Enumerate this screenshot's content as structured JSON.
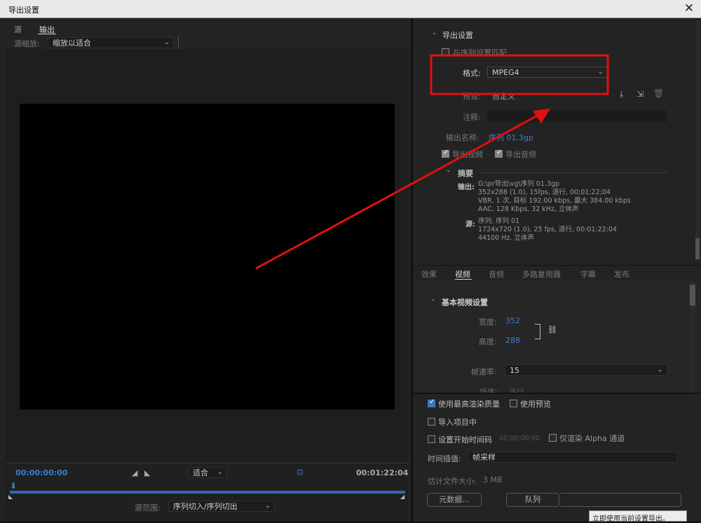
{
  "window": {
    "title": "导出设置",
    "close": "✕"
  },
  "left": {
    "tabs": [
      "源",
      "输出"
    ],
    "scale_label": "源缩放:",
    "scale_value": "缩放以适合",
    "tc_start": "00:00:00:00",
    "tc_end": "00:01:22:04",
    "fit_value": "适合",
    "range_label": "源范围:",
    "range_value": "序列切入/序列切出"
  },
  "export": {
    "section": "导出设置",
    "match_seq": "与序列设置匹配",
    "format_label": "格式:",
    "format_value": "MPEG4",
    "preset_label": "预设:",
    "preset_value": "自定义",
    "comment_label": "注释:",
    "output_name_label": "输出名称:",
    "output_name_value": "序列 01.3gp",
    "export_video": "导出视频",
    "export_audio": "导出音频",
    "summary_title": "摘要",
    "out_key": "输出:",
    "out_lines": [
      "G:\\pr导出\\vg\\序列 01.3gp",
      "352x288 (1.0), 15fps, 逐行, 00;01;22;04",
      "VBR, 1 次, 目标 192.00 kbps, 最大 384.00 kbps",
      "AAC, 128 Kbps, 32  kHz, 立体声"
    ],
    "src_key": "源:",
    "src_lines": [
      "序列, 序列 01",
      "1724x720 (1.0), 25 fps, 逐行, 00:01:22:04",
      "44100 Hz, 立体声"
    ]
  },
  "rtabs": [
    "效果",
    "视频",
    "音频",
    "多路复用器",
    "字幕",
    "发布"
  ],
  "video": {
    "section": "基本视频设置",
    "width_label": "宽度:",
    "width_value": "352",
    "height_label": "高度:",
    "height_value": "288",
    "fps_label": "帧速率:",
    "fps_value": "15",
    "field_label": "场序:",
    "field_value": "逐行"
  },
  "bottom": {
    "max_quality": "使用最高渲染质量",
    "use_preview": "使用预览",
    "import_project": "导入项目中",
    "set_timecode": "设置开始时间码",
    "timecode_value": "00;00;00;00",
    "alpha_only": "仅渲染 Alpha 通道",
    "interp_label": "时间插值:",
    "interp_value": "帧采样",
    "filesize_label": "估计文件大小:",
    "filesize_value": "3 MB",
    "metadata_btn": "元数据...",
    "queue_btn": "队列",
    "tooltip": "立即使用当前设置导出。"
  },
  "colors": {
    "accent": "#3b7fd0",
    "annotation": "#e01010"
  }
}
